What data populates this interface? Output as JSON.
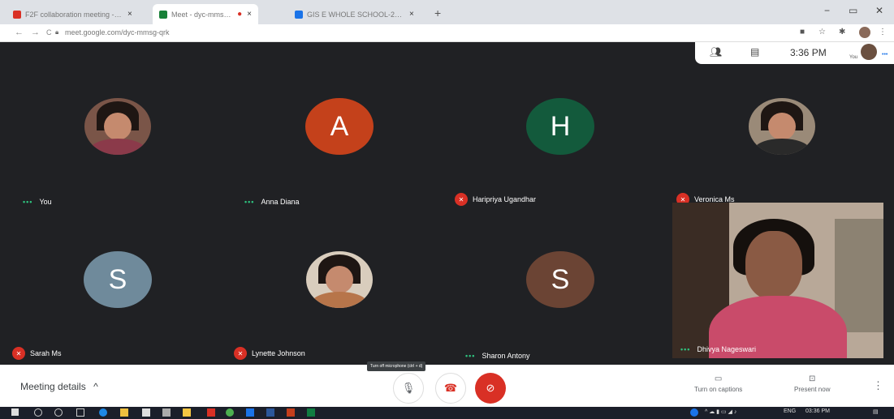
{
  "browser": {
    "tabs": [
      {
        "title": "F2F collaboration meeting - sus",
        "close": "×",
        "color": "#d93025"
      },
      {
        "title": "Meet - dyc-mmsg-qrk",
        "close": "×",
        "color": "#188038"
      },
      {
        "title": "",
        "close": "×",
        "color": "#d93025"
      },
      {
        "title": "GIS E WHOLE SCHOOL-2020-21",
        "close": "×",
        "color": "#1a73e8"
      }
    ],
    "new_tab": "+",
    "window_controls": {
      "minimize": "−",
      "restore": "▭",
      "close": "✕"
    },
    "nav": {
      "back": "←",
      "forward": "→",
      "reload": "C"
    },
    "url": "meet.google.com/dyc-mmsg-qrk"
  },
  "meet_topbar": {
    "time": "3:36 PM",
    "self_label": "You"
  },
  "participants": [
    {
      "name": "You",
      "type": "photo",
      "muted": false,
      "body_color": "#8b3a4a"
    },
    {
      "name": "Anna Diana",
      "type": "initial",
      "initial": "A",
      "color": "#c4411b",
      "muted": false
    },
    {
      "name": "Haripriya Ugandhar",
      "type": "initial",
      "initial": "H",
      "color": "#135a3c",
      "muted": true
    },
    {
      "name": "Veronica Ms",
      "type": "photo",
      "muted": true,
      "body_color": "#2a2a2a"
    },
    {
      "name": "Sarah Ms",
      "type": "initial",
      "initial": "S",
      "color": "#6f8a9b",
      "muted": true
    },
    {
      "name": "Lynette Johnson",
      "type": "photo",
      "muted": true,
      "body_color": "#e8d6c0"
    },
    {
      "name": "Sharon Antony",
      "type": "initial",
      "initial": "S",
      "color": "#6b4434",
      "muted": false
    },
    {
      "name": "Dhivya Nageswari",
      "type": "video",
      "muted": false
    }
  ],
  "controls": {
    "meeting_details": "Meeting details",
    "meeting_details_chevron": "^",
    "tooltip": "Turn off microphone (ctrl + d)",
    "captions": "Turn on captions",
    "present": "Present now"
  },
  "taskbar": {
    "lang": "ENG",
    "clock": "03:36 PM"
  }
}
